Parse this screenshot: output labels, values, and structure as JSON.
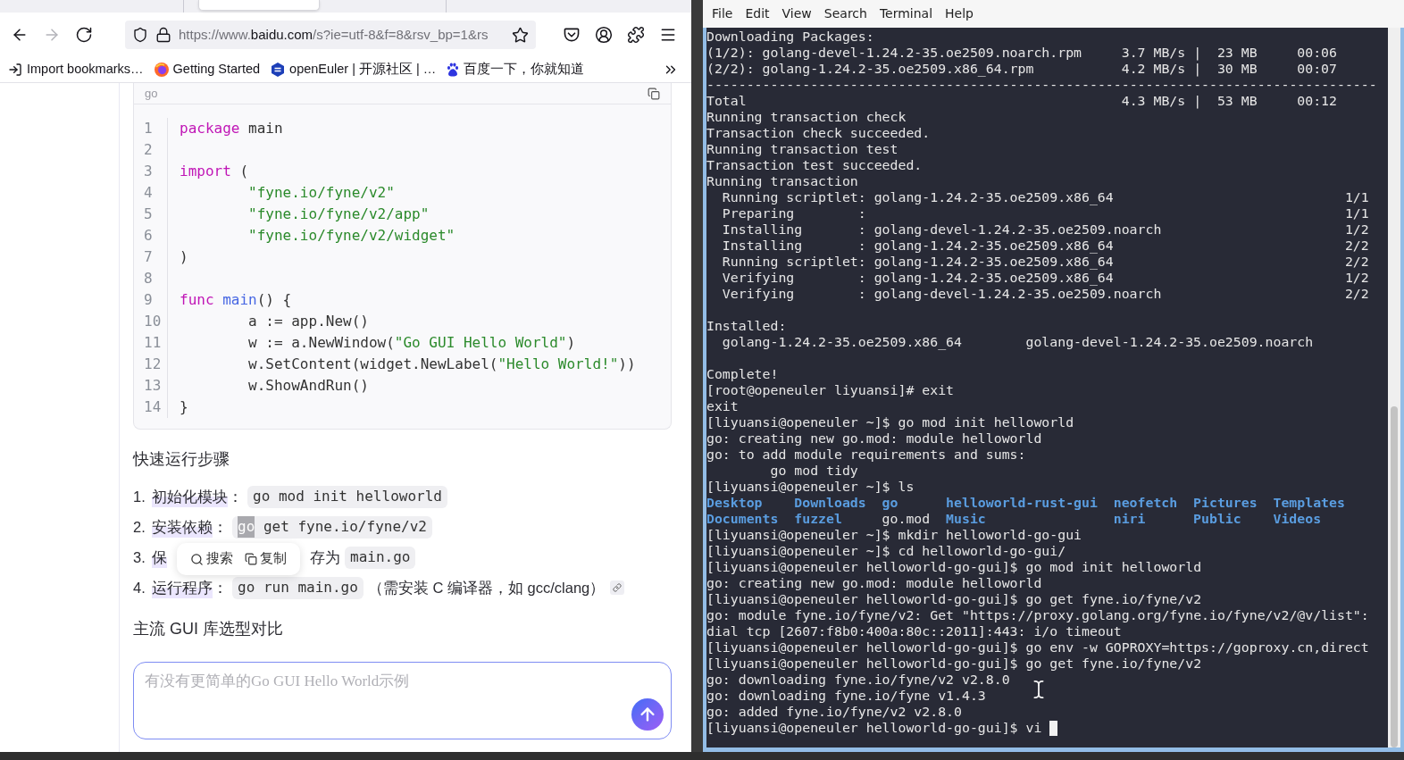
{
  "browser": {
    "tabs": [
      {
        "selected": false
      },
      {
        "selected": true
      },
      {
        "selected": false
      }
    ],
    "nav_buttons": [
      {
        "kind": "back",
        "disabled": false
      },
      {
        "kind": "forward",
        "disabled": true
      },
      {
        "kind": "reload",
        "disabled": false
      }
    ],
    "url": {
      "scheme": "https://www.",
      "domain": "baidu.com",
      "path": "/s?ie=utf-8&f=8&rsv_bp=1&rs"
    },
    "toolbar_buttons": [
      {
        "kind": "pocket"
      },
      {
        "kind": "account"
      },
      {
        "kind": "extensions"
      },
      {
        "kind": "menu"
      }
    ],
    "bookmarks": [
      {
        "kind": "import",
        "label": "Import bookmarks…"
      },
      {
        "kind": "browser",
        "label": "Getting Started"
      },
      {
        "kind": "hexagon",
        "label": "openEuler | 开源社区 | …"
      },
      {
        "kind": "paw",
        "label": "百度一下，你就知道"
      }
    ]
  },
  "page": {
    "code_block": {
      "language": "go",
      "lines": [
        {
          "number": "1",
          "tokens": [
            {
              "kind": "keyword",
              "text": "package"
            },
            {
              "kind": "plain",
              "text": " main"
            }
          ]
        },
        {
          "number": "2"
        },
        {
          "number": "3",
          "tokens": [
            {
              "kind": "keyword",
              "text": "import"
            },
            {
              "kind": "plain",
              "text": " ("
            }
          ]
        },
        {
          "number": "4",
          "tokens": [
            {
              "kind": "string",
              "text": "\t\"fyne.io/fyne/v2\""
            }
          ]
        },
        {
          "number": "5",
          "tokens": [
            {
              "kind": "string",
              "text": "\t\"fyne.io/fyne/v2/app\""
            }
          ]
        },
        {
          "number": "6",
          "tokens": [
            {
              "kind": "string",
              "text": "\t\"fyne.io/fyne/v2/widget\""
            }
          ]
        },
        {
          "number": "7",
          "tokens": [
            {
              "kind": "plain",
              "text": ")"
            }
          ]
        },
        {
          "number": "8"
        },
        {
          "number": "9",
          "tokens": [
            {
              "kind": "keyword",
              "text": "func "
            },
            {
              "kind": "function",
              "text": "main"
            },
            {
              "kind": "plain",
              "text": "() {"
            }
          ]
        },
        {
          "number": "10",
          "tokens": [
            {
              "kind": "plain",
              "text": "\ta := app.New()"
            }
          ]
        },
        {
          "number": "11",
          "tokens": [
            {
              "kind": "plain",
              "text": "\tw := a.NewWindow("
            },
            {
              "kind": "string",
              "text": "\"Go GUI Hello World\""
            },
            {
              "kind": "plain",
              "text": ")"
            }
          ]
        },
        {
          "number": "12",
          "tokens": [
            {
              "kind": "plain",
              "text": "\tw.SetContent(widget.NewLabel("
            },
            {
              "kind": "string",
              "text": "\"Hello World!\""
            },
            {
              "kind": "plain",
              "text": "))"
            }
          ]
        },
        {
          "number": "13",
          "tokens": [
            {
              "kind": "plain",
              "text": "\tw.ShowAndRun()"
            }
          ]
        },
        {
          "number": "14",
          "tokens": [
            {
              "kind": "plain",
              "text": "}"
            }
          ]
        }
      ]
    },
    "steps_heading": "快速运行步骤",
    "steps": [
      {
        "number": "1.",
        "label": "初始化模块",
        "colon": "：",
        "code": [
          {
            "text": "go mod init helloworld",
            "selected": false
          }
        ]
      },
      {
        "number": "2.",
        "label": "安装依赖",
        "colon": "：",
        "code": [
          {
            "text": "go",
            "selected": true
          },
          {
            "text": " get fyne.io/fyne/v2",
            "selected": false
          }
        ]
      },
      {
        "number": "3.",
        "label": "保",
        "popup": [
          {
            "kind": "search",
            "label": "搜索"
          },
          {
            "kind": "copy",
            "label": "复制"
          }
        ],
        "after": "存为",
        "code": [
          {
            "text": "main.go",
            "selected": false
          }
        ]
      },
      {
        "number": "4.",
        "label": "运行程序",
        "colon": "：",
        "code": [
          {
            "text": "go run main.go",
            "selected": false
          }
        ],
        "note": "（需安装 C 编译器，如 gcc/clang）",
        "link": true
      }
    ],
    "comparison_heading": "主流 GUI 库选型对比",
    "chat_input": {
      "placeholder": "有没有更简单的Go GUI Hello World示例"
    }
  },
  "terminal": {
    "menu": [
      "File",
      "Edit",
      "View",
      "Search",
      "Terminal",
      "Help"
    ],
    "lines": [
      {
        "kind": "text",
        "text": "Downloading Packages:"
      },
      {
        "kind": "download",
        "file": "(1/2): golang-devel-1.24.2-35.oe2509.noarch.rpm",
        "speed": "3.7 MB/s",
        "separator": "|",
        "size": "23 MB",
        "time": "00:06"
      },
      {
        "kind": "download",
        "file": "(2/2): golang-1.24.2-35.oe2509.x86_64.rpm",
        "speed": "4.2 MB/s",
        "separator": "|",
        "size": "30 MB",
        "time": "00:07"
      },
      {
        "kind": "text",
        "text": "------------------------------------------------------------------------------------"
      },
      {
        "kind": "download",
        "file": "Total",
        "speed": "4.3 MB/s",
        "separator": "|",
        "size": "53 MB",
        "time": "00:12"
      },
      {
        "kind": "text",
        "text": "Running transaction check"
      },
      {
        "kind": "text",
        "text": "Transaction check succeeded."
      },
      {
        "kind": "text",
        "text": "Running transaction test"
      },
      {
        "kind": "text",
        "text": "Transaction test succeeded."
      },
      {
        "kind": "text",
        "text": "Running transaction"
      },
      {
        "kind": "transaction",
        "action": "Running scriptlet",
        "colon": ":",
        "package": "golang-1.24.2-35.oe2509.x86_64",
        "count": "1/1"
      },
      {
        "kind": "transaction",
        "action": "Preparing",
        "colon": ":",
        "count": "1/1"
      },
      {
        "kind": "transaction",
        "action": "Installing",
        "colon": ":",
        "package": "golang-devel-1.24.2-35.oe2509.noarch",
        "count": "1/2"
      },
      {
        "kind": "transaction",
        "action": "Installing",
        "colon": ":",
        "package": "golang-1.24.2-35.oe2509.x86_64",
        "count": "2/2"
      },
      {
        "kind": "transaction",
        "action": "Running scriptlet",
        "colon": ":",
        "package": "golang-1.24.2-35.oe2509.x86_64",
        "count": "2/2"
      },
      {
        "kind": "transaction",
        "action": "Verifying",
        "colon": ":",
        "package": "golang-1.24.2-35.oe2509.x86_64",
        "count": "1/2"
      },
      {
        "kind": "transaction",
        "action": "Verifying",
        "colon": ":",
        "package": "golang-devel-1.24.2-35.oe2509.noarch",
        "count": "2/2"
      },
      {
        "kind": "blank"
      },
      {
        "kind": "text",
        "text": "Installed:"
      },
      {
        "kind": "installed",
        "packages": [
          "golang-1.24.2-35.oe2509.x86_64",
          "golang-devel-1.24.2-35.oe2509.noarch"
        ]
      },
      {
        "kind": "blank"
      },
      {
        "kind": "text",
        "text": "Complete!"
      },
      {
        "kind": "text",
        "text": "[root@openeuler liyuansi]# exit"
      },
      {
        "kind": "text",
        "text": "exit"
      },
      {
        "kind": "text",
        "text": "[liyuansi@openeuler ~]$ go mod init helloworld"
      },
      {
        "kind": "text",
        "text": "go: creating new go.mod: module helloworld"
      },
      {
        "kind": "text",
        "text": "go: to add module requirements and sums:"
      },
      {
        "kind": "text",
        "text": "\tgo mod tidy"
      },
      {
        "kind": "text",
        "text": "[liyuansi@openeuler ~]$ ls"
      },
      {
        "kind": "ls",
        "entries": [
          {
            "name": "Desktop",
            "kind": "dir"
          },
          {
            "name": "Downloads",
            "kind": "dir"
          },
          {
            "name": "go",
            "kind": "dir"
          },
          {
            "name": "helloworld-rust-gui",
            "kind": "dir"
          },
          {
            "name": "neofetch",
            "kind": "dir"
          },
          {
            "name": "Pictures",
            "kind": "dir"
          },
          {
            "name": "Templates",
            "kind": "dir"
          }
        ]
      },
      {
        "kind": "ls",
        "entries": [
          {
            "name": "Documents",
            "kind": "dir"
          },
          {
            "name": "fuzzel",
            "kind": "dir"
          },
          {
            "name": "go.mod",
            "kind": "file"
          },
          {
            "name": "Music",
            "kind": "dir"
          },
          {
            "name": "niri",
            "kind": "dir"
          },
          {
            "name": "Public",
            "kind": "dir"
          },
          {
            "name": "Videos",
            "kind": "dir"
          }
        ]
      },
      {
        "kind": "text",
        "text": "[liyuansi@openeuler ~]$ mkdir helloworld-go-gui"
      },
      {
        "kind": "text",
        "text": "[liyuansi@openeuler ~]$ cd helloworld-go-gui/"
      },
      {
        "kind": "text",
        "text": "[liyuansi@openeuler helloworld-go-gui]$ go mod init helloworld"
      },
      {
        "kind": "text",
        "text": "go: creating new go.mod: module helloworld"
      },
      {
        "kind": "text",
        "text": "[liyuansi@openeuler helloworld-go-gui]$ go get fyne.io/fyne/v2"
      },
      {
        "kind": "text",
        "text": "go: module fyne.io/fyne/v2: Get \"https://proxy.golang.org/fyne.io/fyne/v2/@v/list\":"
      },
      {
        "kind": "text",
        "text": "dial tcp [2607:f8b0:400a:80c::2011]:443: i/o timeout"
      },
      {
        "kind": "text",
        "text": "[liyuansi@openeuler helloworld-go-gui]$ go env -w GOPROXY=https://goproxy.cn,direct"
      },
      {
        "kind": "text",
        "text": "[liyuansi@openeuler helloworld-go-gui]$ go get fyne.io/fyne/v2"
      },
      {
        "kind": "text",
        "text": "go: downloading fyne.io/fyne/v2 v2.8.0"
      },
      {
        "kind": "text",
        "text": "go: downloading fyne.io/fyne v1.4.3"
      },
      {
        "kind": "text",
        "text": "go: added fyne.io/fyne/v2 v2.8.0"
      },
      {
        "kind": "input",
        "text": "[liyuansi@openeuler helloworld-go-gui]$ vi"
      }
    ]
  }
}
